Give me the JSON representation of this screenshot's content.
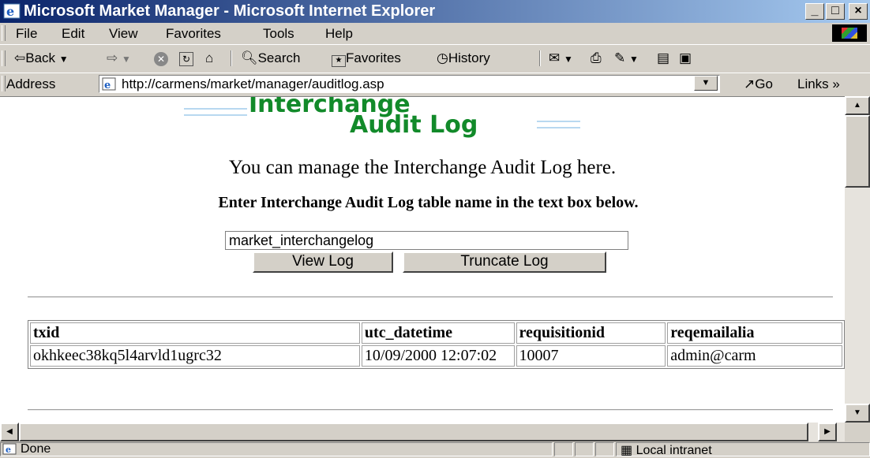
{
  "window": {
    "title": "Microsoft Market Manager - Microsoft Internet Explorer",
    "minimize_glyph": "_",
    "maximize_glyph": "□",
    "close_glyph": "×"
  },
  "menu": [
    "File",
    "Edit",
    "View",
    "Favorites",
    "Tools",
    "Help"
  ],
  "toolbar": {
    "back": "⇦Back",
    "search": "Search",
    "favorites": "Favorites",
    "history": "History"
  },
  "address": {
    "label": "Address",
    "url": "http://carmens/market/manager/auditlog.asp",
    "go": "Go",
    "links": "Links »"
  },
  "page": {
    "heading_line1": "Interchange",
    "heading_line2": "Audit Log",
    "intro": "You can manage the Interchange Audit Log here.",
    "instruction": "Enter Interchange Audit Log table name in the text box below.",
    "table_name_value": "market_interchangelog",
    "view_log_button": "View Log",
    "truncate_log_button": "Truncate Log"
  },
  "log_table": {
    "headers": [
      "txid",
      "utc_datetime",
      "requisitionid",
      "reqemailalia"
    ],
    "rows": [
      [
        "okhkeec38kq5l4arvld1ugrc32",
        "10/09/2000 12:07:02",
        "10007",
        "admin@carm"
      ]
    ]
  },
  "status": {
    "text": "Done",
    "zone": "Local intranet"
  },
  "colors": {
    "title_gradient_start": "#0a246a",
    "heading_green": "#128a2a",
    "chrome": "#d4d0c8"
  }
}
